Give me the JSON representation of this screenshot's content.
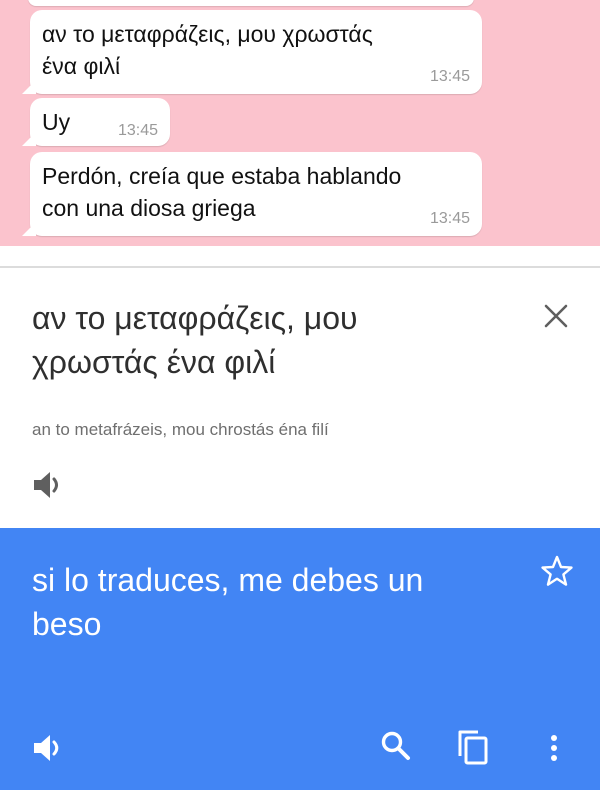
{
  "chat": {
    "messages": [
      {
        "text_line1": "αν το μεταφράζεις, μου χρωστάς",
        "text_line2": "ένα φιλί",
        "time": "13:45"
      },
      {
        "text": "Uy",
        "time": "13:45"
      },
      {
        "text_line1": "Perdón, creía que estaba hablando",
        "text_line2": "con una diosa griega",
        "time": "13:45"
      }
    ],
    "colors": {
      "background": "#fbc3cd",
      "bubble": "#ffffff"
    }
  },
  "translate": {
    "source_line1": "αν το μεταφράζεις, μου",
    "source_line2": "χρωστάς ένα φιλί",
    "transliteration": "an to metafrázeis, mou chrostás éna filí",
    "result_line1": "si lo traduces, me debes un",
    "result_line2": "beso",
    "icons": {
      "close": "close-icon",
      "speaker": "speaker-icon",
      "star": "star-icon",
      "search": "search-icon",
      "copy": "copy-icon",
      "more": "more-vert-icon"
    },
    "colors": {
      "result_background": "#4285f4",
      "result_text": "#ffffff"
    }
  }
}
